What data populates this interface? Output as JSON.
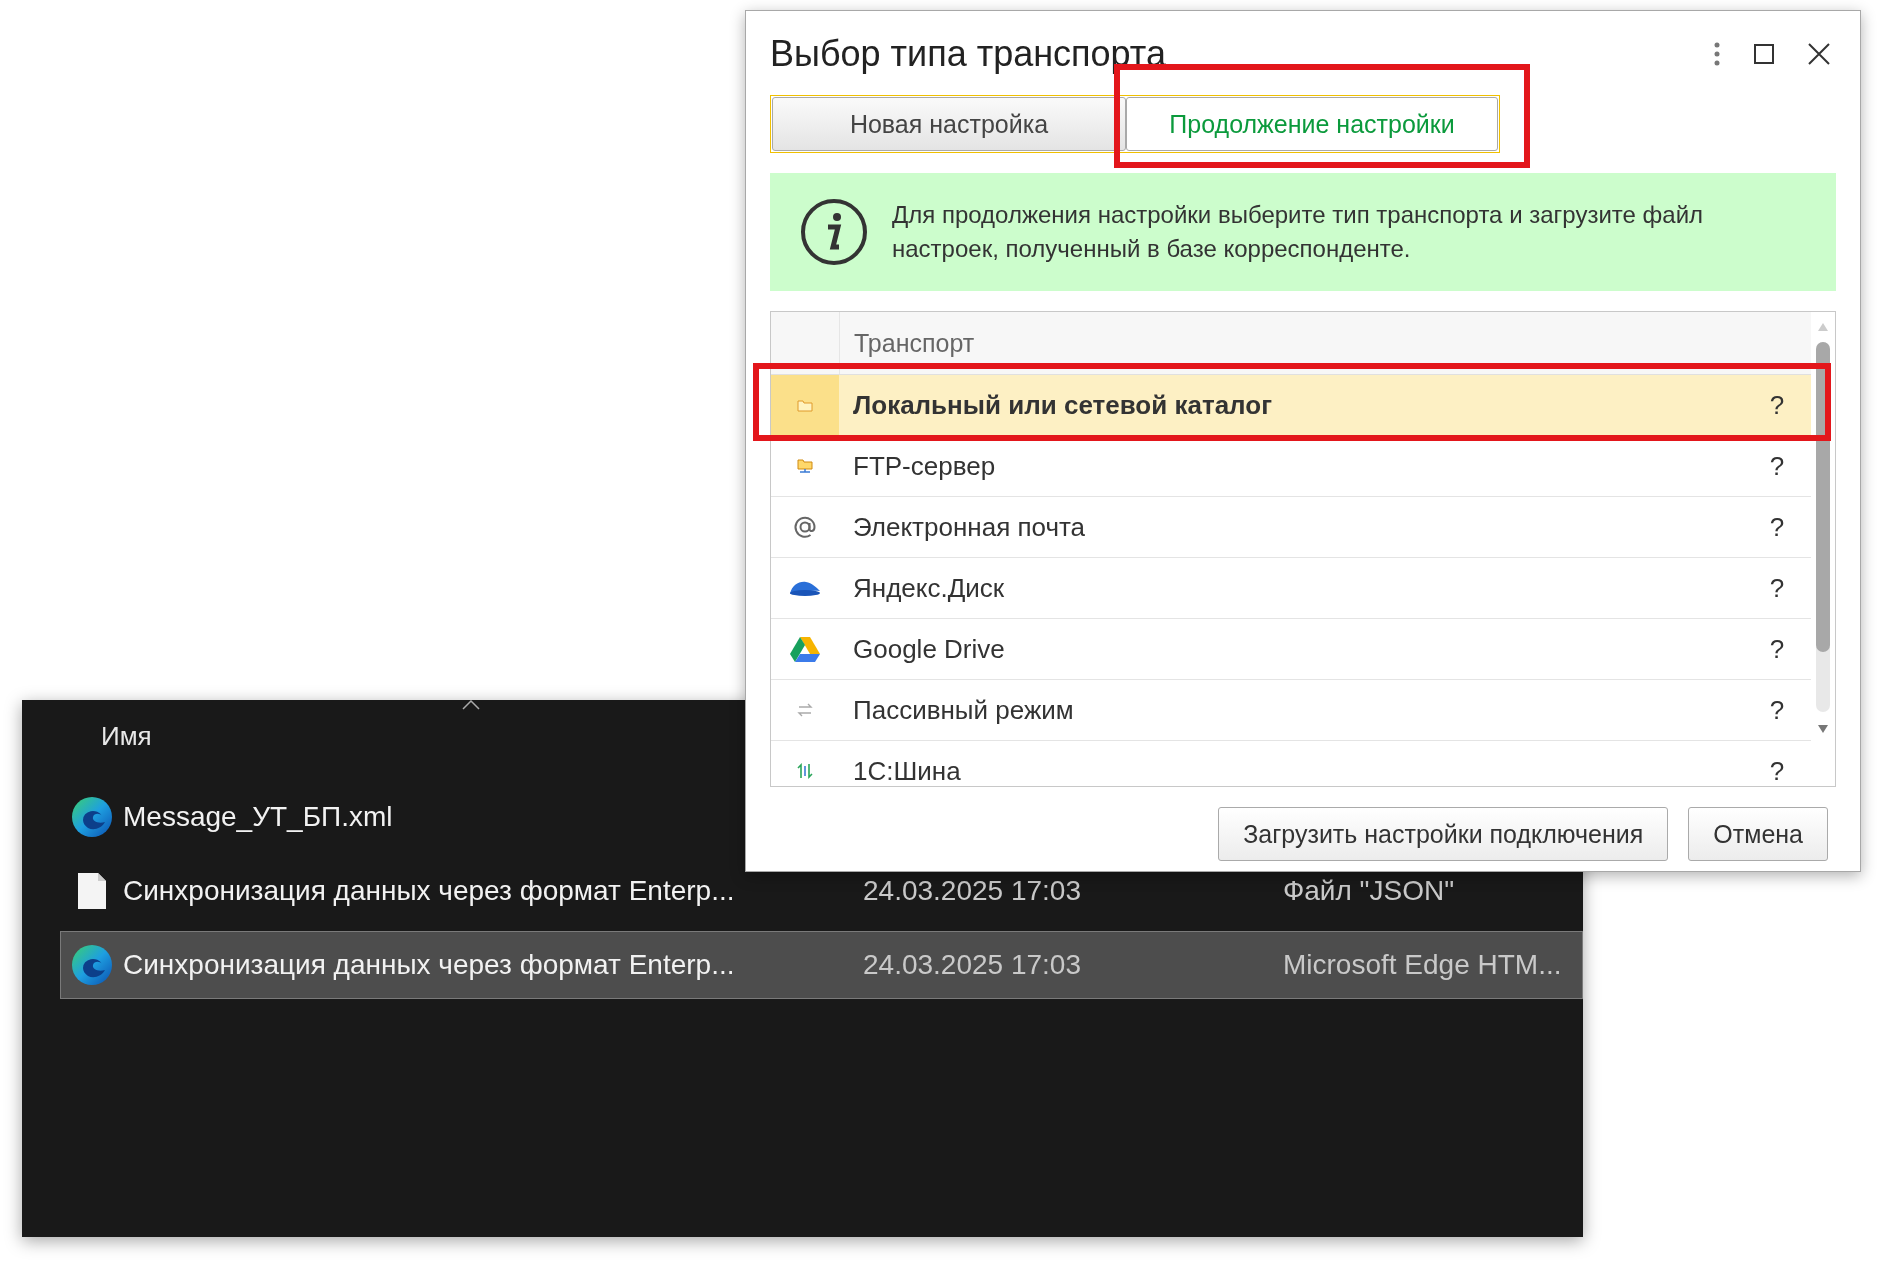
{
  "explorer": {
    "columns": [
      "Имя"
    ],
    "rows": [
      {
        "kind": "edge",
        "name": "Message_УТ_БП.xml",
        "date": "",
        "type": "",
        "selected": false
      },
      {
        "kind": "file",
        "name": "Синхронизация данных через формат Enterp...",
        "date": "24.03.2025 17:03",
        "type": "Файл \"JSON\"",
        "selected": false
      },
      {
        "kind": "edge",
        "name": "Синхронизация данных через формат Enterp...",
        "date": "24.03.2025 17:03",
        "type": "Microsoft Edge HTM...",
        "selected": true
      }
    ]
  },
  "dialog": {
    "title": "Выбор типа транспорта",
    "tabs": [
      {
        "label": "Новая настройка",
        "selected": false,
        "highlighted": false
      },
      {
        "label": "Продолжение настройки",
        "selected": true,
        "highlighted": true
      }
    ],
    "info": "Для продолжения настройки выберите тип транспорта и загрузите файл настроек, полученный в базе корреспонденте.",
    "table": {
      "column": "Транспорт",
      "rows": [
        {
          "kind": "folder",
          "name": "Локальный или сетевой каталог",
          "help": "?",
          "selected": true,
          "highlighted": true
        },
        {
          "kind": "ftp",
          "name": "FTP-сервер",
          "help": "?",
          "selected": false,
          "highlighted": false
        },
        {
          "kind": "email",
          "name": "Электронная почта",
          "help": "?",
          "selected": false,
          "highlighted": false
        },
        {
          "kind": "cloud",
          "name": "Яндекс.Диск",
          "help": "?",
          "selected": false,
          "highlighted": false
        },
        {
          "kind": "drive",
          "name": "Google Drive",
          "help": "?",
          "selected": false,
          "highlighted": false
        },
        {
          "kind": "passive",
          "name": "Пассивный режим",
          "help": "?",
          "selected": false,
          "highlighted": false
        },
        {
          "kind": "bus",
          "name": "1С:Шина",
          "help": "?",
          "selected": false,
          "highlighted": false
        }
      ]
    },
    "buttons": [
      "Загрузить настройки подключения",
      "Отмена"
    ]
  }
}
